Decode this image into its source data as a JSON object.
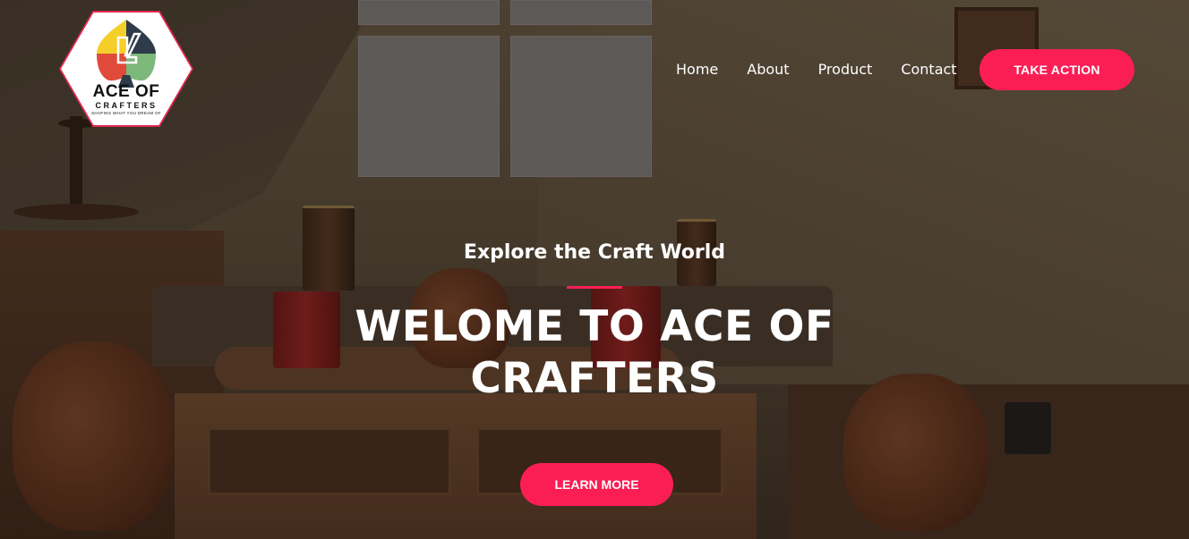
{
  "brand": {
    "title": "ACE OF",
    "subtitle": "CRAFTERS",
    "tagline": "SHAPING WHAT YOU DREAM OF",
    "icon": "spade-chair-logo-icon",
    "colors": {
      "yellow": "#f4cf2a",
      "dark": "#2f3b4a",
      "red": "#e04a3a",
      "green": "#7cb87a",
      "border": "#e0284f"
    }
  },
  "nav": {
    "items": [
      {
        "label": "Home"
      },
      {
        "label": "About"
      },
      {
        "label": "Product"
      },
      {
        "label": "Contact"
      }
    ],
    "cta_label": "TAKE ACTION"
  },
  "hero": {
    "subtitle": "Explore the Craft World",
    "headline": "WELOME TO ACE OF CRAFTERS",
    "button_label": "LEARN MORE"
  },
  "colors": {
    "accent": "#fb1e55",
    "text": "#ffffff"
  }
}
